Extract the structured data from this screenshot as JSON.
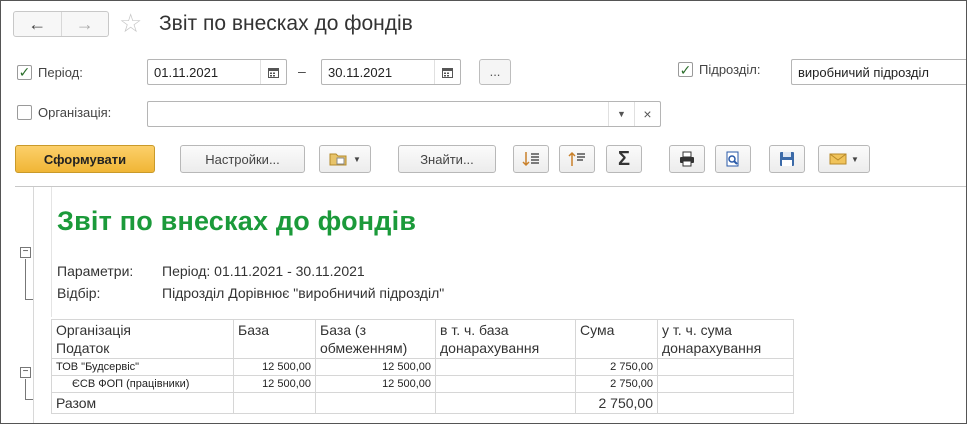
{
  "header": {
    "title": "Звіт по внесках до фондів",
    "back_icon": "←",
    "forward_icon": "→",
    "star_icon": "☆"
  },
  "filters": {
    "period": {
      "label": "Період:",
      "checked": "✓",
      "from": "01.11.2021",
      "to": "30.11.2021",
      "dash": "–",
      "ellipsis": "..."
    },
    "subdivision": {
      "label": "Підрозділ:",
      "checked": "✓",
      "value": "виробничий підрозділ"
    },
    "organization": {
      "label": "Організація:",
      "value": "",
      "clear": "×"
    }
  },
  "toolbar": {
    "generate": "Сформувати",
    "settings": "Настройки...",
    "find": "Знайти...",
    "sum_symbol": "Σ"
  },
  "report": {
    "title": "Звіт по внесках до фондів",
    "params_label": "Параметри:",
    "params_value": "Період: 01.11.2021 - 30.11.2021",
    "filter_label": "Відбір:",
    "filter_value": "Підрозділ Дорівнює \"виробничий підрозділ\"",
    "columns": {
      "org_line1": "Організація",
      "org_line2": "Податок",
      "base": "База",
      "base_limited_l1": "База (з",
      "base_limited_l2": "обмеженням)",
      "base_extra_l1": "в т. ч. база",
      "base_extra_l2": "донарахування",
      "sum": "Сума",
      "sum_extra_l1": "у т. ч. сума",
      "sum_extra_l2": "донарахування"
    },
    "rows": [
      {
        "name": "ТОВ \"Будсервіс\"",
        "base": "12 500,00",
        "base_limited": "12 500,00",
        "base_extra": "",
        "sum": "2 750,00",
        "sum_extra": ""
      },
      {
        "name": "ЄСВ ФОП (працівники)",
        "base": "12 500,00",
        "base_limited": "12 500,00",
        "base_extra": "",
        "sum": "2 750,00",
        "sum_extra": ""
      }
    ],
    "total": {
      "label": "Разом",
      "sum": "2 750,00"
    }
  }
}
